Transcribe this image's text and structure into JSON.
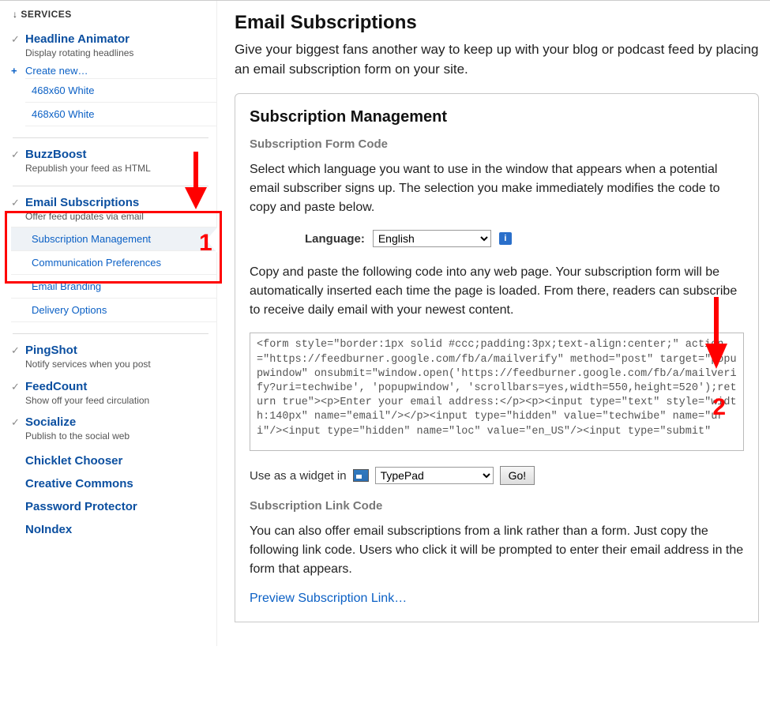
{
  "sidebar": {
    "header": "↓ SERVICES",
    "headline_animator": {
      "title": "Headline Animator",
      "desc": "Display rotating headlines"
    },
    "create_new": "Create new…",
    "size_items": [
      "468x60 White",
      "468x60 White"
    ],
    "buzzboost": {
      "title": "BuzzBoost",
      "desc": "Republish your feed as HTML"
    },
    "email_subs": {
      "title": "Email Subscriptions",
      "desc": "Offer feed updates via email"
    },
    "email_sub_items": [
      "Subscription Management",
      "Communication Preferences",
      "Email Branding",
      "Delivery Options"
    ],
    "pingshot": {
      "title": "PingShot",
      "desc": "Notify services when you post"
    },
    "feedcount": {
      "title": "FeedCount",
      "desc": "Show off your feed circulation"
    },
    "socialize": {
      "title": "Socialize",
      "desc": "Publish to the social web"
    },
    "bottom_links": [
      "Chicklet Chooser",
      "Creative Commons",
      "Password Protector",
      "NoIndex"
    ]
  },
  "main": {
    "page_title": "Email Subscriptions",
    "intro": "Give your biggest fans another way to keep up with your blog or podcast feed by placing an email subscription form on your site.",
    "panel_title": "Subscription Management",
    "form_code_heading": "Subscription Form Code",
    "form_code_text": "Select which language you want to use in the window that appears when a potential email subscriber signs up. The selection you make immediately modifies the code to copy and paste below.",
    "language_label": "Language:",
    "language_selected": "English",
    "copy_text": "Copy and paste the following code into any web page. Your subscription form will be automatically inserted each time the page is loaded. From there, readers can subscribe to receive daily email with your newest content.",
    "code_snippet": "<form style=\"border:1px solid #ccc;padding:3px;text-align:center;\" action=\"https://feedburner.google.com/fb/a/mailverify\" method=\"post\" target=\"popupwindow\" onsubmit=\"window.open('https://feedburner.google.com/fb/a/mailverify?uri=techwibe', 'popupwindow', 'scrollbars=yes,width=550,height=520');return true\"><p>Enter your email address:</p><p><input type=\"text\" style=\"width:140px\" name=\"email\"/></p><input type=\"hidden\" value=\"techwibe\" name=\"uri\"/><input type=\"hidden\" name=\"loc\" value=\"en_US\"/><input type=\"submit\"",
    "widget_label": "Use as a widget in",
    "widget_selected": "TypePad",
    "go_label": "Go!",
    "link_code_heading": "Subscription Link Code",
    "link_code_text": "You can also offer email subscriptions from a link rather than a form. Just copy the following link code. Users who click it will be prompted to enter their email address in the form that appears.",
    "preview_link": "Preview Subscription Link…"
  },
  "annotations": {
    "num1": "1",
    "num2": "2"
  }
}
